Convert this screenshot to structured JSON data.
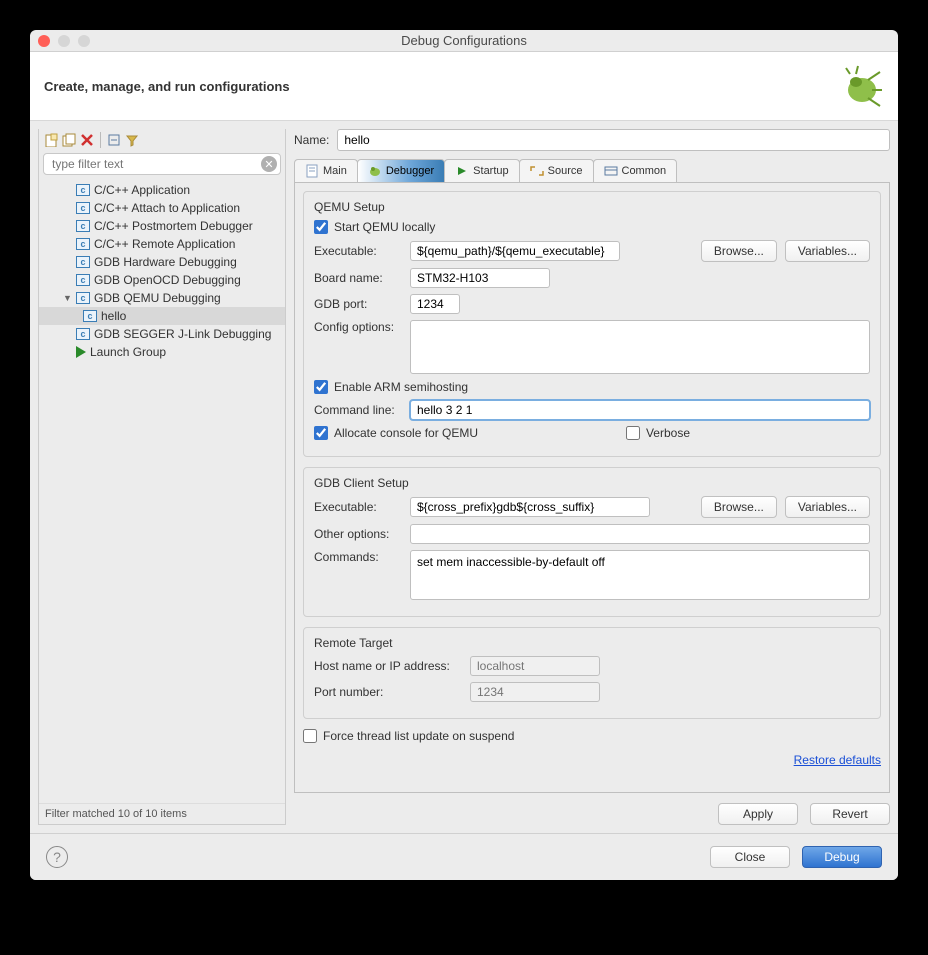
{
  "window": {
    "title": "Debug Configurations"
  },
  "header": {
    "title": "Create, manage, and run configurations"
  },
  "sidebar": {
    "filter_placeholder": "type filter text",
    "items": [
      {
        "label": "C/C++ Application",
        "icon": "c"
      },
      {
        "label": "C/C++ Attach to Application",
        "icon": "c"
      },
      {
        "label": "C/C++ Postmortem Debugger",
        "icon": "c"
      },
      {
        "label": "C/C++ Remote Application",
        "icon": "c"
      },
      {
        "label": "GDB Hardware Debugging",
        "icon": "c"
      },
      {
        "label": "GDB OpenOCD Debugging",
        "icon": "c"
      },
      {
        "label": "GDB QEMU Debugging",
        "icon": "c",
        "expanded": true,
        "children": [
          {
            "label": "hello",
            "icon": "c",
            "selected": true
          }
        ]
      },
      {
        "label": "GDB SEGGER J-Link Debugging",
        "icon": "c"
      },
      {
        "label": "Launch Group",
        "icon": "launch"
      }
    ],
    "status": "Filter matched 10 of 10 items"
  },
  "main": {
    "name_label": "Name:",
    "name_value": "hello",
    "tabs": [
      {
        "label": "Main",
        "icon": "doc"
      },
      {
        "label": "Debugger",
        "icon": "bug",
        "active": true
      },
      {
        "label": "Startup",
        "icon": "play"
      },
      {
        "label": "Source",
        "icon": "src"
      },
      {
        "label": "Common",
        "icon": "common"
      }
    ],
    "qemu": {
      "title": "QEMU Setup",
      "start_locally_label": "Start QEMU locally",
      "start_locally": true,
      "executable_label": "Executable:",
      "executable": "${qemu_path}/${qemu_executable}",
      "browse": "Browse...",
      "variables": "Variables...",
      "board_label": "Board name:",
      "board": "STM32-H103",
      "gdb_port_label": "GDB port:",
      "gdb_port": "1234",
      "config_label": "Config options:",
      "config": "",
      "semihost_label": "Enable ARM semihosting",
      "semihost": true,
      "cmdline_label": "Command line:",
      "cmdline": "hello 3 2 1",
      "alloc_console_label": "Allocate console for QEMU",
      "alloc_console": true,
      "verbose_label": "Verbose",
      "verbose": false
    },
    "gdb": {
      "title": "GDB Client Setup",
      "executable_label": "Executable:",
      "executable": "${cross_prefix}gdb${cross_suffix}",
      "browse": "Browse...",
      "variables": "Variables...",
      "other_label": "Other options:",
      "other": "",
      "commands_label": "Commands:",
      "commands": "set mem inaccessible-by-default off"
    },
    "remote": {
      "title": "Remote Target",
      "host_label": "Host name or IP address:",
      "host_placeholder": "localhost",
      "port_label": "Port number:",
      "port_placeholder": "1234"
    },
    "force_thread_label": "Force thread list update on suspend",
    "force_thread": false,
    "restore_link": "Restore defaults",
    "apply": "Apply",
    "revert": "Revert"
  },
  "footer": {
    "close": "Close",
    "debug": "Debug"
  }
}
